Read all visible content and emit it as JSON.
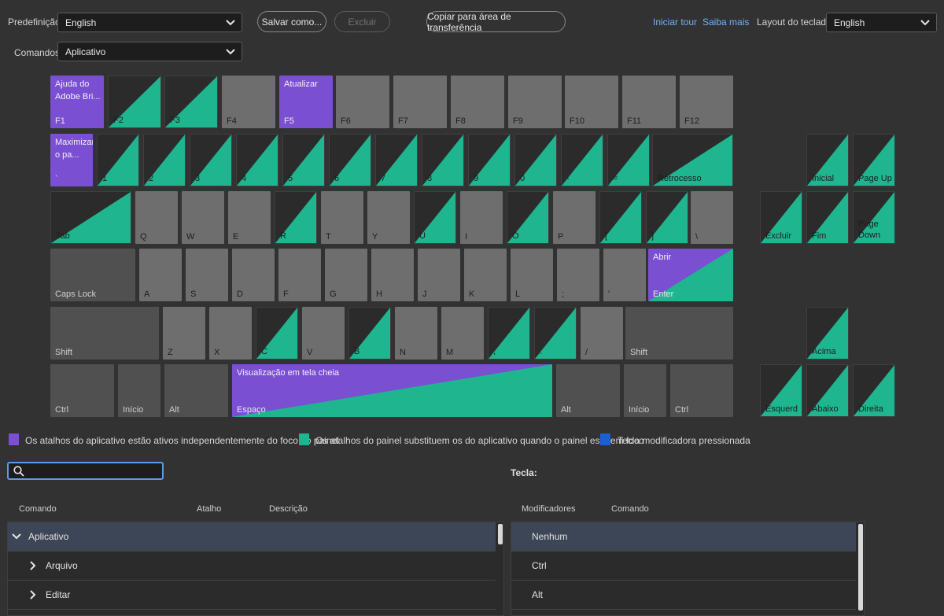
{
  "toolbar": {
    "preset_label": "Predefinição:",
    "preset_value": "English",
    "save_as": "Salvar como...",
    "delete": "Excluir",
    "copy_clipboard": "Copiar para área de transferência",
    "start_tour": "Iniciar tour",
    "learn_more": "Saiba mais",
    "layout_label": "Layout do teclado:",
    "layout_value": "English",
    "commands_label": "Comandos:",
    "commands_value": "Aplicativo"
  },
  "colors": {
    "app": "#7a4fd1",
    "panel": "#1fb58f",
    "modifier": "#1e5fd0",
    "key": "#6e6e6e",
    "mod_key": "#505050",
    "accent": "#5b9bea"
  },
  "keys": {
    "f1_cmd": "Ajuda do Adobe Bri...",
    "f1": "F1",
    "f2": "F2",
    "f3": "F3",
    "f4": "F4",
    "f5_cmd": "Atualizar",
    "f5": "F5",
    "f6": "F6",
    "f7": "F7",
    "f8": "F8",
    "f9": "F9",
    "f10": "F10",
    "f11": "F11",
    "f12": "F12",
    "grave_cmd": "Maximizar o pa...",
    "grave": "`",
    "n1": "1",
    "n2": "2",
    "n3": "3",
    "n4": "4",
    "n5": "5",
    "n6": "6",
    "n7": "7",
    "n8": "8",
    "n9": "9",
    "n0": "0",
    "minus": "-",
    "equals": "=",
    "backspace": "Retrocesso",
    "home_nav": "Inicial",
    "pageup": "Page Up",
    "tab": "Tab",
    "q": "Q",
    "w": "W",
    "e": "E",
    "r": "R",
    "t": "T",
    "y": "Y",
    "u": "U",
    "i": "I",
    "o": "O",
    "p": "P",
    "lbracket": "[",
    "rbracket": "]",
    "backslash": "\\",
    "delete": "Excluir",
    "end": "Fim",
    "pagedown": "Page Down",
    "capslock": "Caps Lock",
    "a": "A",
    "s": "S",
    "d": "D",
    "f": "F",
    "g": "G",
    "h": "H",
    "j": "J",
    "k": "K",
    "l": "L",
    "semicolon": ";",
    "quote": "'",
    "enter_cmd": "Abrir",
    "enter": "Enter",
    "shift": "Shift",
    "z": "Z",
    "x": "X",
    "c": "C",
    "v": "V",
    "b": "B",
    "n": "N",
    "m": "M",
    "comma": ",",
    "period": ".",
    "slash": "/",
    "shift_r": "Shift",
    "up": "Acima",
    "ctrl": "Ctrl",
    "win": "Início",
    "alt": "Alt",
    "space_cmd": "Visualização em tela cheia",
    "space": "Espaço",
    "alt_r": "Alt",
    "win_r": "Início",
    "ctrl_r": "Ctrl",
    "left": "Esquerd",
    "down": "Abaixo",
    "right": "Direita"
  },
  "legend": {
    "app": "Os atalhos do aplicativo estão ativos independentemente do foco no painel",
    "panel": "Os atalhos do painel substituem os do aplicativo quando o painel está em foco",
    "modifier": "Tecla modificadora pressionada"
  },
  "search": {
    "placeholder": ""
  },
  "key_label": "Tecla:",
  "commands_table": {
    "headers": {
      "command": "Comando",
      "shortcut": "Atalho",
      "description": "Descrição"
    },
    "rows": [
      {
        "label": "Aplicativo"
      },
      {
        "label": "Arquivo"
      },
      {
        "label": "Editar"
      }
    ]
  },
  "modifiers_table": {
    "headers": {
      "modifiers": "Modificadores",
      "command": "Comando"
    },
    "rows": [
      {
        "label": "Nenhum"
      },
      {
        "label": "Ctrl"
      },
      {
        "label": "Alt"
      }
    ]
  }
}
